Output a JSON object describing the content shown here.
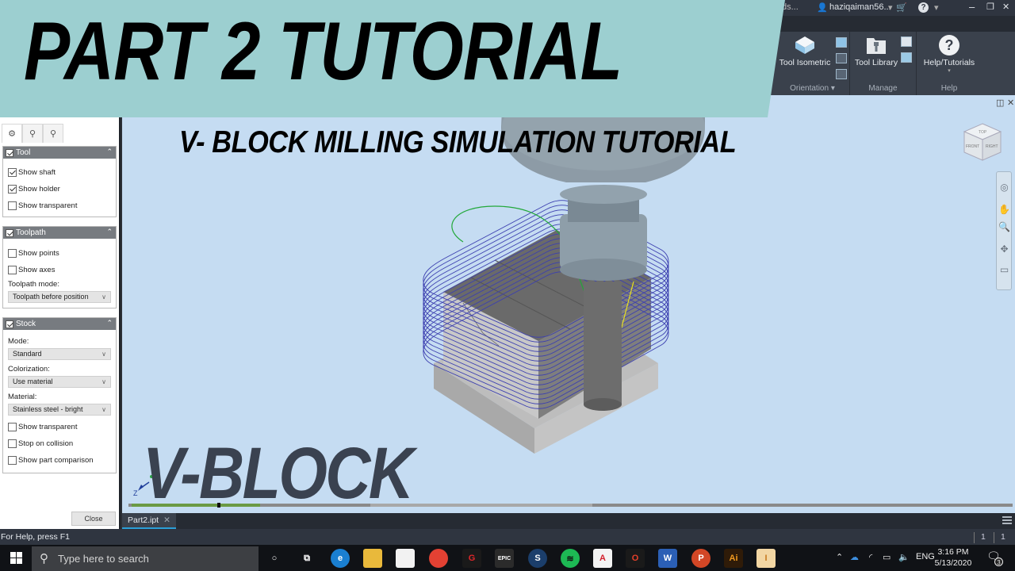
{
  "titlebar": {
    "truncated_left": "ds...",
    "user": "haziqaiman56...",
    "help_menu": "?"
  },
  "ribbon": {
    "groups": [
      {
        "label": "Orientation",
        "has_dropdown": true,
        "buttons": [
          {
            "label": "Tool Isometric",
            "icon": "isometric-cube-icon"
          }
        ],
        "small_buttons": [
          "view-top-icon",
          "view-front-icon",
          "view-side-icon"
        ]
      },
      {
        "label": "Manage",
        "buttons": [
          {
            "label": "Tool Library",
            "icon": "tool-library-icon"
          }
        ],
        "small_buttons": [
          "list-icon",
          "image-icon"
        ]
      },
      {
        "label": "Help",
        "buttons": [
          {
            "label": "Help/Tutorials",
            "icon": "help-circle-icon"
          }
        ]
      }
    ]
  },
  "banner": {
    "title": "PART 2 TUTORIAL",
    "background": "#9ccfd0"
  },
  "overlay": {
    "subtitle": "V- BLOCK MILLING SIMULATION TUTORIAL",
    "big_label": "V-BLOCK"
  },
  "left_panel": {
    "tabs": [
      "tool-display-icon",
      "toolpath-display-icon",
      "stock-display-icon"
    ],
    "sections": {
      "tool": {
        "title": "Tool",
        "enabled": true,
        "options": [
          {
            "label": "Show shaft",
            "checked": true
          },
          {
            "label": "Show holder",
            "checked": true
          },
          {
            "label": "Show transparent",
            "checked": false
          }
        ]
      },
      "toolpath": {
        "title": "Toolpath",
        "enabled": true,
        "options": [
          {
            "label": "Show points",
            "checked": false
          },
          {
            "label": "Show axes",
            "checked": false
          }
        ],
        "mode_label": "Toolpath mode:",
        "mode_value": "Toolpath before position"
      },
      "stock": {
        "title": "Stock",
        "enabled": true,
        "mode_label": "Mode:",
        "mode_value": "Standard",
        "colorization_label": "Colorization:",
        "colorization_value": "Use material",
        "material_label": "Material:",
        "material_value": "Stainless steel - bright",
        "options": [
          {
            "label": "Show transparent",
            "checked": false
          },
          {
            "label": "Stop on collision",
            "checked": false
          },
          {
            "label": "Show part comparison",
            "checked": false
          }
        ]
      }
    },
    "close_label": "Close"
  },
  "viewport": {
    "viewcube_faces": {
      "top": "TOP",
      "front": "FRONT",
      "right": "RIGHT"
    },
    "axis_label": "Z",
    "timeline_progress": 0.1
  },
  "document_tabs": [
    {
      "label": "Part2.ipt",
      "active": true,
      "close": "✕"
    }
  ],
  "status_bar": {
    "help_text": "For Help, press F1",
    "counters": [
      "1",
      "1"
    ]
  },
  "taskbar": {
    "search_placeholder": "Type here to search",
    "apps": [
      {
        "name": "cortana",
        "glyph": "○"
      },
      {
        "name": "task-view",
        "glyph": "⧉"
      },
      {
        "name": "edge",
        "glyph": "e"
      },
      {
        "name": "file-explorer",
        "glyph": ""
      },
      {
        "name": "microsoft-store",
        "glyph": ""
      },
      {
        "name": "chrome",
        "glyph": ""
      },
      {
        "name": "garena",
        "glyph": "G"
      },
      {
        "name": "epic-games",
        "glyph": "EPIC"
      },
      {
        "name": "steam",
        "glyph": "S"
      },
      {
        "name": "spotify",
        "glyph": "≋"
      },
      {
        "name": "autocad",
        "glyph": "A"
      },
      {
        "name": "office",
        "glyph": "O"
      },
      {
        "name": "word",
        "glyph": "W"
      },
      {
        "name": "powerpoint",
        "glyph": "P"
      },
      {
        "name": "illustrator",
        "glyph": "Ai"
      },
      {
        "name": "inventor",
        "glyph": "I"
      }
    ],
    "tray": {
      "language": "ENG",
      "time": "3:16 PM",
      "date": "5/13/2020",
      "notifications": "3"
    }
  }
}
